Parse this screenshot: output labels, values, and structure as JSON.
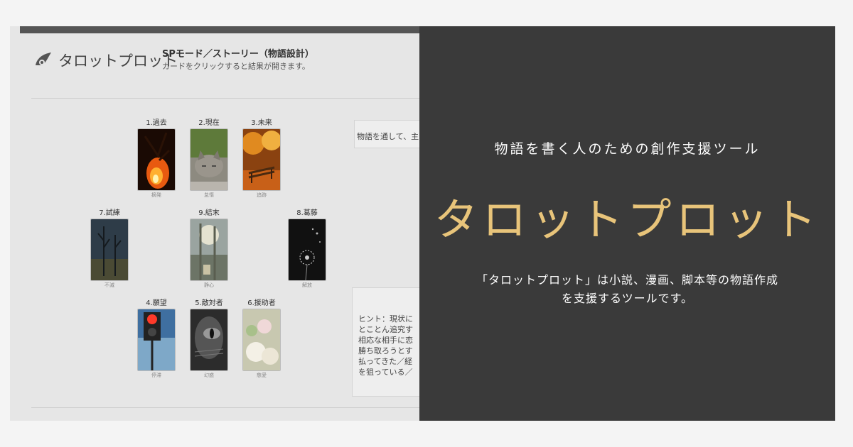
{
  "app": {
    "logo_text": "タロットプロット",
    "mode_title": "SPモード／ストーリー（物語設計）",
    "mode_subtitle": "カードをクリックすると結果が開きます。"
  },
  "cards": [
    {
      "label": "1.過去",
      "caption": "摘発"
    },
    {
      "label": "2.現在",
      "caption": "怠惰"
    },
    {
      "label": "3.未来",
      "caption": "追跡"
    },
    {
      "label": "7.試練",
      "caption": "不滅"
    },
    {
      "label": "9.結末",
      "caption": "静心"
    },
    {
      "label": "8.葛藤",
      "caption": "解放"
    },
    {
      "label": "4.願望",
      "caption": "停滞"
    },
    {
      "label": "5.敵対者",
      "caption": "幻惑"
    },
    {
      "label": "6.援助者",
      "caption": "慈愛"
    }
  ],
  "result_panel": {
    "text": "物語を通して、主"
  },
  "hint_panel": {
    "lines": [
      "ヒント：現状に",
      "とことん追究す",
      "相応な相手に恋",
      "勝ち取ろうとす",
      "払ってきた／経",
      "を狙っている／"
    ]
  },
  "overlay": {
    "tagline": "物語を書く人のための創作支援ツール",
    "big_title": "タロットプロット",
    "desc_line1": "「タロットプロット」は小説、漫画、脚本等の物語作成",
    "desc_line2": "を支援するツールです。",
    "accent_color": "#e8c47a",
    "bg_color": "#3a3a3a"
  }
}
